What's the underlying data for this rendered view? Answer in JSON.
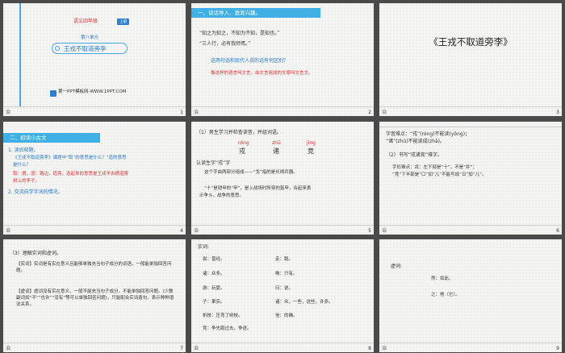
{
  "s1": {
    "grade": "语文四年级",
    "badge": "上册",
    "unit": "第八单元",
    "title": "王戎不取道旁李",
    "site": "第一PPT模板网-WWW.1PPT.COM",
    "num": "1"
  },
  "s2": {
    "header": "一、谈话导入，激发兴趣。",
    "q1": "“知之为知之，不知为不知，是知也。”",
    "q2": "“三人行，必有我师焉。”",
    "question": "这两句话和现代人说的话有何区别？",
    "answer": "像这样的语言叫文言，由文言组成的文章叫文言文。",
    "num": "2"
  },
  "s3": {
    "title": "《王戎不取道旁李》",
    "num": "3"
  },
  "s4": {
    "header": "二、初读小古文",
    "l1": "1. 读后释题。",
    "l2": "《王戎不取道旁李》课题中“取”的意思是什么？“道的意思",
    "l3": "是什么？",
    "a1": "取：摘，道：路边，道旁，连起来的意思是王戎不去摘道旁",
    "a2": "树上的李子。",
    "l4": "2. 交流自学字词的情况。",
    "num": "4"
  },
  "s5": {
    "intro": "（1）男生学习并检查读音，并组词语。",
    "py1": "róng",
    "py2": "zhū",
    "py3": "jìng",
    "c1": "戎",
    "c2": "诸",
    "c3": "竞",
    "l1": "认读生字“戎”字",
    "l2": "这个字由两部分组成——“戈”指的是长柄兵器。",
    "l3": "“十”是铠甲的“甲”，是上战场时所穿的盔甲，合起来表",
    "l4": "示争斗，战争的意思。",
    "num": "5"
  },
  "s6": {
    "l1": "字音难点：“戎”(róng)不能读(yǒng)；",
    "l2": "“诸”(zhū)不能读成(zhā)。",
    "l3": "（2）书写“戎诸竞”难字。",
    "l4": "字形难点：戎：左下部是“十”，不是“井”；",
    "l5": "“竞”下半部是“口”加“儿”不能写成“日”加“儿”。",
    "num": "6"
  },
  "s7": {
    "intro": "（3）理解实词和虚词。",
    "n1": "【实词】实词是有实在意义且能够单独充当句子成分的词语，一般能单独回答问题。",
    "n2": "【虚词】虚词没有实在意义，一般不能充当句子成分，不能单独回答问题。(少数副词如“不”“也许”“没有”等可以单独回答问题)，只能配合实词造句，表示种种语法关系。",
    "num": "7"
  },
  "s8": {
    "header": "实词:",
    "left": [
      "尝：曾经。",
      "诸：众多。",
      "游：玩耍。",
      "子：果实。",
      "折枝：压弯了树枝。",
      "竞：争先跑过去，争逐。"
    ],
    "right": [
      "走：跑。",
      "唯：只有。",
      "曰：说。",
      "诸：众，一些，这些，许多。",
      "信：的确。"
    ],
    "num": "8"
  },
  "s9": {
    "header": "虚词:",
    "l1": "然：如此。",
    "l2": "之：他（它）。",
    "num": "9"
  },
  "footer_icon": "治"
}
